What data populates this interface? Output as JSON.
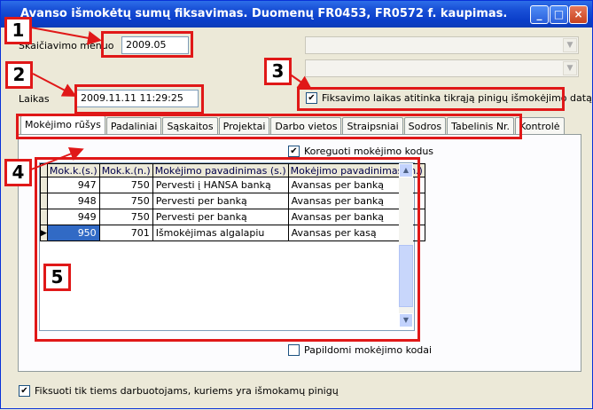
{
  "window": {
    "title": "Avanso išmokėtų sumų fiksavimas. Duomenų FR0453, FR0572 f. kaupimas.",
    "btn_min": "_",
    "btn_max": "□",
    "btn_close": "×"
  },
  "form": {
    "month_label": "Skaičiavimo mėnuo",
    "month_value": "2009.05",
    "time_label": "Laikas",
    "time_value": "2009.11.11 11:29:25",
    "fix_time_checkbox": "Fiksavimo laikas atitinka tikrąją pinigų išmokėjimo datą",
    "fix_time_checked": true
  },
  "tabs": [
    {
      "label": "Mokėjimo rūšys",
      "active": true
    },
    {
      "label": "Padaliniai"
    },
    {
      "label": "Sąskaitos"
    },
    {
      "label": "Projektai"
    },
    {
      "label": "Darbo vietos"
    },
    {
      "label": "Straipsniai"
    },
    {
      "label": "Sodros"
    },
    {
      "label": "Tabelinis Nr."
    },
    {
      "label": "Kontrolė"
    }
  ],
  "panel": {
    "correct_codes_checkbox": "Koreguoti mokėjimo kodus",
    "correct_codes_checked": true,
    "extra_codes_checkbox": "Papildomi mokėjimo kodai",
    "extra_codes_checked": false
  },
  "grid": {
    "columns": [
      "Mok.k.(s.)",
      "Mok.k.(n.)",
      "Mokėjimo pavadinimas (s.)",
      "Mokėjimo pavadinimas (n.)"
    ],
    "rows": [
      [
        "947",
        "750",
        "Pervesti į HANSA banką",
        "Avansas per banką"
      ],
      [
        "948",
        "750",
        "Pervesti per banką",
        "Avansas per banką"
      ],
      [
        "949",
        "750",
        "Pervesti per banką",
        "Avansas per banką"
      ],
      [
        "950",
        "701",
        "Išmokėjimas algalapiu",
        "Avansas per kasą"
      ]
    ],
    "selected_row": 3
  },
  "footer": {
    "only_paid_checkbox": "Fiksuoti tik tiems darbuotojams, kuriems yra išmokamų pinigų",
    "only_paid_checked": true
  },
  "callouts": [
    "1",
    "2",
    "3",
    "4",
    "5"
  ],
  "colors": {
    "callout_red": "#e01818",
    "titlebar_blue": "#0a3dc8",
    "selection_blue": "#316ac5"
  }
}
